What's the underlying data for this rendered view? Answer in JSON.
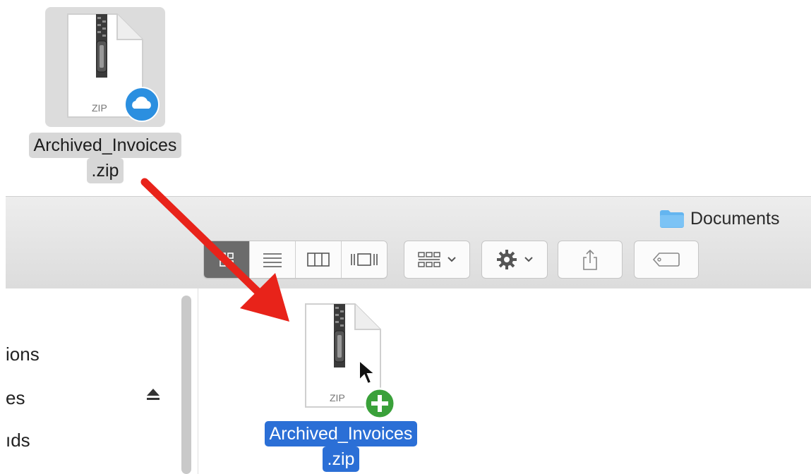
{
  "dragged_file": {
    "name_line1": "Archived_Invoices",
    "name_line2": ".zip",
    "type_label": "ZIP",
    "badge": "cloud-icon"
  },
  "finder": {
    "window_title": "Documents",
    "title_icon": "folder-icon",
    "view_buttons": [
      "icon-view",
      "list-view",
      "column-view",
      "cover-flow-view"
    ],
    "active_view": "icon-view",
    "toolbar_buttons": [
      "arrange-button",
      "action-button",
      "share-button",
      "tags-button"
    ],
    "sidebar_items": [
      "ions",
      "es",
      "ıds"
    ],
    "file": {
      "name_line1": "Archived_Invoices",
      "name_line2": ".zip",
      "type_label": "ZIP",
      "badge": "copy-plus-icon"
    }
  },
  "colors": {
    "arrow": "#e8231a",
    "selection": "#2b6fd6",
    "cloud_badge": "#2b8fe0",
    "plus_badge": "#3aa13a",
    "folder": "#64b5f0"
  }
}
